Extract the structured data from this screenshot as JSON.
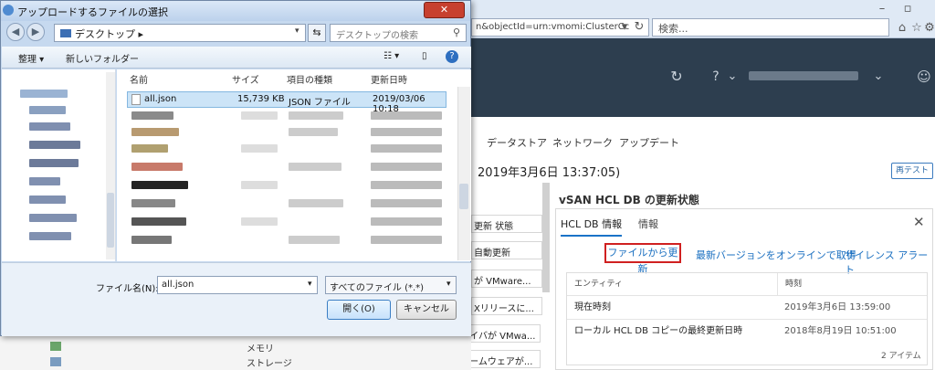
{
  "browser": {
    "url": "n&objectId=urn:vmomi:ClusterCc",
    "search_placeholder": "検索..."
  },
  "vsphere": {
    "tabs": [
      "データストア",
      "ネットワーク",
      "アップデート"
    ],
    "heading": "2019年3月6日 13:37:05)",
    "retest_label": "再テスト",
    "list_items": [
      "更新 状態",
      "自動更新",
      "が VMware...",
      "Xリリースに...",
      "コントローラ ドライバが VMwa...",
      "コントローラ ファームウェアが..."
    ],
    "bottom_labels": [
      "メモリ",
      "ストレージ"
    ],
    "hcl": {
      "title": "vSAN HCL DB の更新状態",
      "tab_info": "HCL DB 情報",
      "tab_detail": "情報",
      "link_update_file": "ファイルから更新",
      "link_update_online": "最新バージョンをオンラインで取得",
      "link_silence": "サイレンス アラート",
      "table_headers": [
        "エンティティ",
        "時刻"
      ],
      "rows": [
        [
          "現在時刻",
          "2019年3月6日 13:59:00"
        ],
        [
          "ローカル HCL DB コピーの最終更新日時",
          "2018年8月19日 10:51:00"
        ]
      ],
      "item_count": "2 アイテム"
    }
  },
  "dialog": {
    "title": "アップロードするファイルの選択",
    "location": "デスクトップ",
    "search_placeholder": "デスクトップの検索",
    "toolbar": {
      "organize": "整理 ▾",
      "new_folder": "新しいフォルダー"
    },
    "columns": [
      "名前",
      "サイズ",
      "項目の種類",
      "更新日時"
    ],
    "selected_file": {
      "name": "all.json",
      "size": "15,739 KB",
      "type": "JSON ファイル",
      "modified": "2019/03/06 10:18"
    },
    "filename_label": "ファイル名(N):",
    "filename_value": "all.json",
    "filetype_value": "すべてのファイル (*.*)",
    "open_label": "開く(O)",
    "cancel_label": "キャンセル"
  }
}
